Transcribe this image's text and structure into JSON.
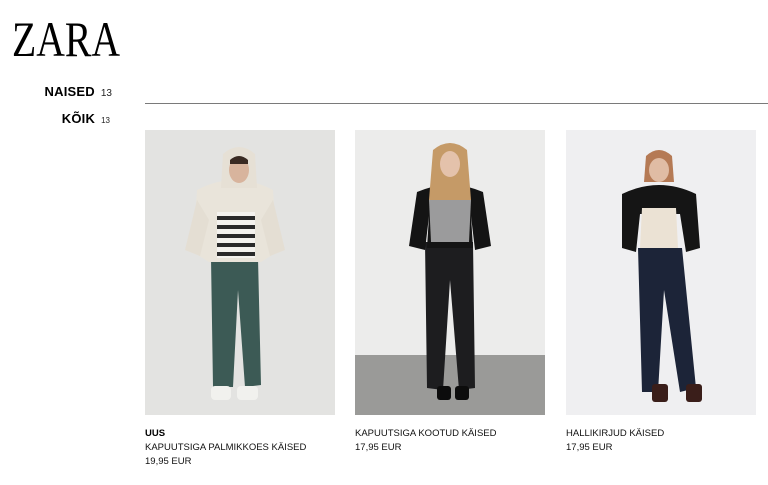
{
  "brand": {
    "logo_text": "ZARA"
  },
  "nav": {
    "category": {
      "label": "NAISED",
      "count": "13"
    },
    "subcategory": {
      "label": "KÕIK",
      "count": "13"
    }
  },
  "products": [
    {
      "badge": "UUS",
      "name": "KAPUUTSIGA PALMIKKOES KÄISED",
      "price": "19,95 EUR"
    },
    {
      "name": "KAPUUTSIGA KOOTUD KÄISED",
      "price": "17,95 EUR"
    },
    {
      "name": "HALLIKIRJUD KÄISED",
      "price": "17,95 EUR"
    }
  ]
}
